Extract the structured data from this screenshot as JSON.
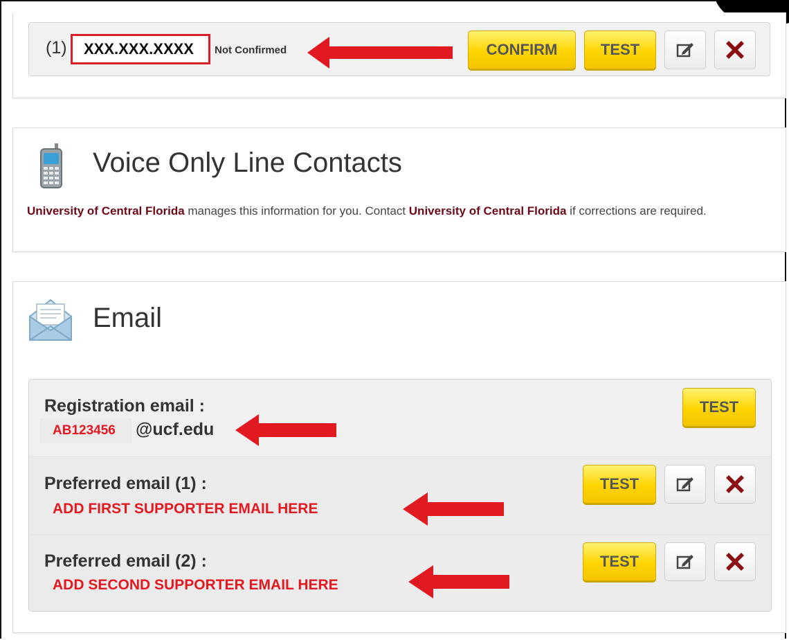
{
  "phone_section": {
    "index": "(1)",
    "number": "XXX.XXX.XXXX",
    "status": "Not Confirmed",
    "confirm_label": "CONFIRM",
    "test_label": "TEST"
  },
  "voice_section": {
    "title": "Voice Only Line Contacts",
    "note_org": "University of Central Florida",
    "note_mid": " manages this information for you. Contact ",
    "note_org2": "University of Central Florida",
    "note_end": " if corrections are required."
  },
  "email_section": {
    "title": "Email",
    "rows": [
      {
        "label": "Registration email :",
        "value": "AB123456",
        "domain": "@ucf.edu",
        "test_label": "TEST"
      },
      {
        "label": "Preferred email (1) :",
        "value": "ADD FIRST SUPPORTER EMAIL HERE",
        "test_label": "TEST"
      },
      {
        "label": "Preferred email (2) :",
        "value": "ADD SECOND SUPPORTER EMAIL HERE",
        "test_label": "TEST"
      }
    ]
  },
  "icons": {
    "edit": "edit-icon",
    "delete": "close-icon",
    "phone": "mobile-phone-icon",
    "email": "envelope-icon",
    "arrow": "arrow-left-icon"
  },
  "colors": {
    "annotation_red": "#e11a22",
    "button_yellow": "#ffd400",
    "org_maroon": "#6d0a1a"
  }
}
